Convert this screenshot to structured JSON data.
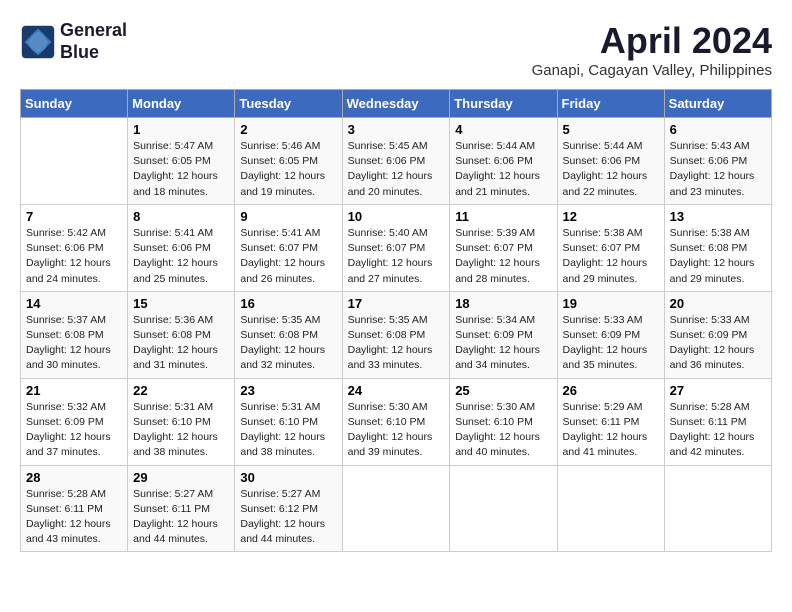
{
  "logo": {
    "line1": "General",
    "line2": "Blue"
  },
  "title": "April 2024",
  "location": "Ganapi, Cagayan Valley, Philippines",
  "days_header": [
    "Sunday",
    "Monday",
    "Tuesday",
    "Wednesday",
    "Thursday",
    "Friday",
    "Saturday"
  ],
  "weeks": [
    [
      {
        "num": "",
        "info": ""
      },
      {
        "num": "1",
        "info": "Sunrise: 5:47 AM\nSunset: 6:05 PM\nDaylight: 12 hours\nand 18 minutes."
      },
      {
        "num": "2",
        "info": "Sunrise: 5:46 AM\nSunset: 6:05 PM\nDaylight: 12 hours\nand 19 minutes."
      },
      {
        "num": "3",
        "info": "Sunrise: 5:45 AM\nSunset: 6:06 PM\nDaylight: 12 hours\nand 20 minutes."
      },
      {
        "num": "4",
        "info": "Sunrise: 5:44 AM\nSunset: 6:06 PM\nDaylight: 12 hours\nand 21 minutes."
      },
      {
        "num": "5",
        "info": "Sunrise: 5:44 AM\nSunset: 6:06 PM\nDaylight: 12 hours\nand 22 minutes."
      },
      {
        "num": "6",
        "info": "Sunrise: 5:43 AM\nSunset: 6:06 PM\nDaylight: 12 hours\nand 23 minutes."
      }
    ],
    [
      {
        "num": "7",
        "info": "Sunrise: 5:42 AM\nSunset: 6:06 PM\nDaylight: 12 hours\nand 24 minutes."
      },
      {
        "num": "8",
        "info": "Sunrise: 5:41 AM\nSunset: 6:06 PM\nDaylight: 12 hours\nand 25 minutes."
      },
      {
        "num": "9",
        "info": "Sunrise: 5:41 AM\nSunset: 6:07 PM\nDaylight: 12 hours\nand 26 minutes."
      },
      {
        "num": "10",
        "info": "Sunrise: 5:40 AM\nSunset: 6:07 PM\nDaylight: 12 hours\nand 27 minutes."
      },
      {
        "num": "11",
        "info": "Sunrise: 5:39 AM\nSunset: 6:07 PM\nDaylight: 12 hours\nand 28 minutes."
      },
      {
        "num": "12",
        "info": "Sunrise: 5:38 AM\nSunset: 6:07 PM\nDaylight: 12 hours\nand 29 minutes."
      },
      {
        "num": "13",
        "info": "Sunrise: 5:38 AM\nSunset: 6:08 PM\nDaylight: 12 hours\nand 29 minutes."
      }
    ],
    [
      {
        "num": "14",
        "info": "Sunrise: 5:37 AM\nSunset: 6:08 PM\nDaylight: 12 hours\nand 30 minutes."
      },
      {
        "num": "15",
        "info": "Sunrise: 5:36 AM\nSunset: 6:08 PM\nDaylight: 12 hours\nand 31 minutes."
      },
      {
        "num": "16",
        "info": "Sunrise: 5:35 AM\nSunset: 6:08 PM\nDaylight: 12 hours\nand 32 minutes."
      },
      {
        "num": "17",
        "info": "Sunrise: 5:35 AM\nSunset: 6:08 PM\nDaylight: 12 hours\nand 33 minutes."
      },
      {
        "num": "18",
        "info": "Sunrise: 5:34 AM\nSunset: 6:09 PM\nDaylight: 12 hours\nand 34 minutes."
      },
      {
        "num": "19",
        "info": "Sunrise: 5:33 AM\nSunset: 6:09 PM\nDaylight: 12 hours\nand 35 minutes."
      },
      {
        "num": "20",
        "info": "Sunrise: 5:33 AM\nSunset: 6:09 PM\nDaylight: 12 hours\nand 36 minutes."
      }
    ],
    [
      {
        "num": "21",
        "info": "Sunrise: 5:32 AM\nSunset: 6:09 PM\nDaylight: 12 hours\nand 37 minutes."
      },
      {
        "num": "22",
        "info": "Sunrise: 5:31 AM\nSunset: 6:10 PM\nDaylight: 12 hours\nand 38 minutes."
      },
      {
        "num": "23",
        "info": "Sunrise: 5:31 AM\nSunset: 6:10 PM\nDaylight: 12 hours\nand 38 minutes."
      },
      {
        "num": "24",
        "info": "Sunrise: 5:30 AM\nSunset: 6:10 PM\nDaylight: 12 hours\nand 39 minutes."
      },
      {
        "num": "25",
        "info": "Sunrise: 5:30 AM\nSunset: 6:10 PM\nDaylight: 12 hours\nand 40 minutes."
      },
      {
        "num": "26",
        "info": "Sunrise: 5:29 AM\nSunset: 6:11 PM\nDaylight: 12 hours\nand 41 minutes."
      },
      {
        "num": "27",
        "info": "Sunrise: 5:28 AM\nSunset: 6:11 PM\nDaylight: 12 hours\nand 42 minutes."
      }
    ],
    [
      {
        "num": "28",
        "info": "Sunrise: 5:28 AM\nSunset: 6:11 PM\nDaylight: 12 hours\nand 43 minutes."
      },
      {
        "num": "29",
        "info": "Sunrise: 5:27 AM\nSunset: 6:11 PM\nDaylight: 12 hours\nand 44 minutes."
      },
      {
        "num": "30",
        "info": "Sunrise: 5:27 AM\nSunset: 6:12 PM\nDaylight: 12 hours\nand 44 minutes."
      },
      {
        "num": "",
        "info": ""
      },
      {
        "num": "",
        "info": ""
      },
      {
        "num": "",
        "info": ""
      },
      {
        "num": "",
        "info": ""
      }
    ]
  ]
}
